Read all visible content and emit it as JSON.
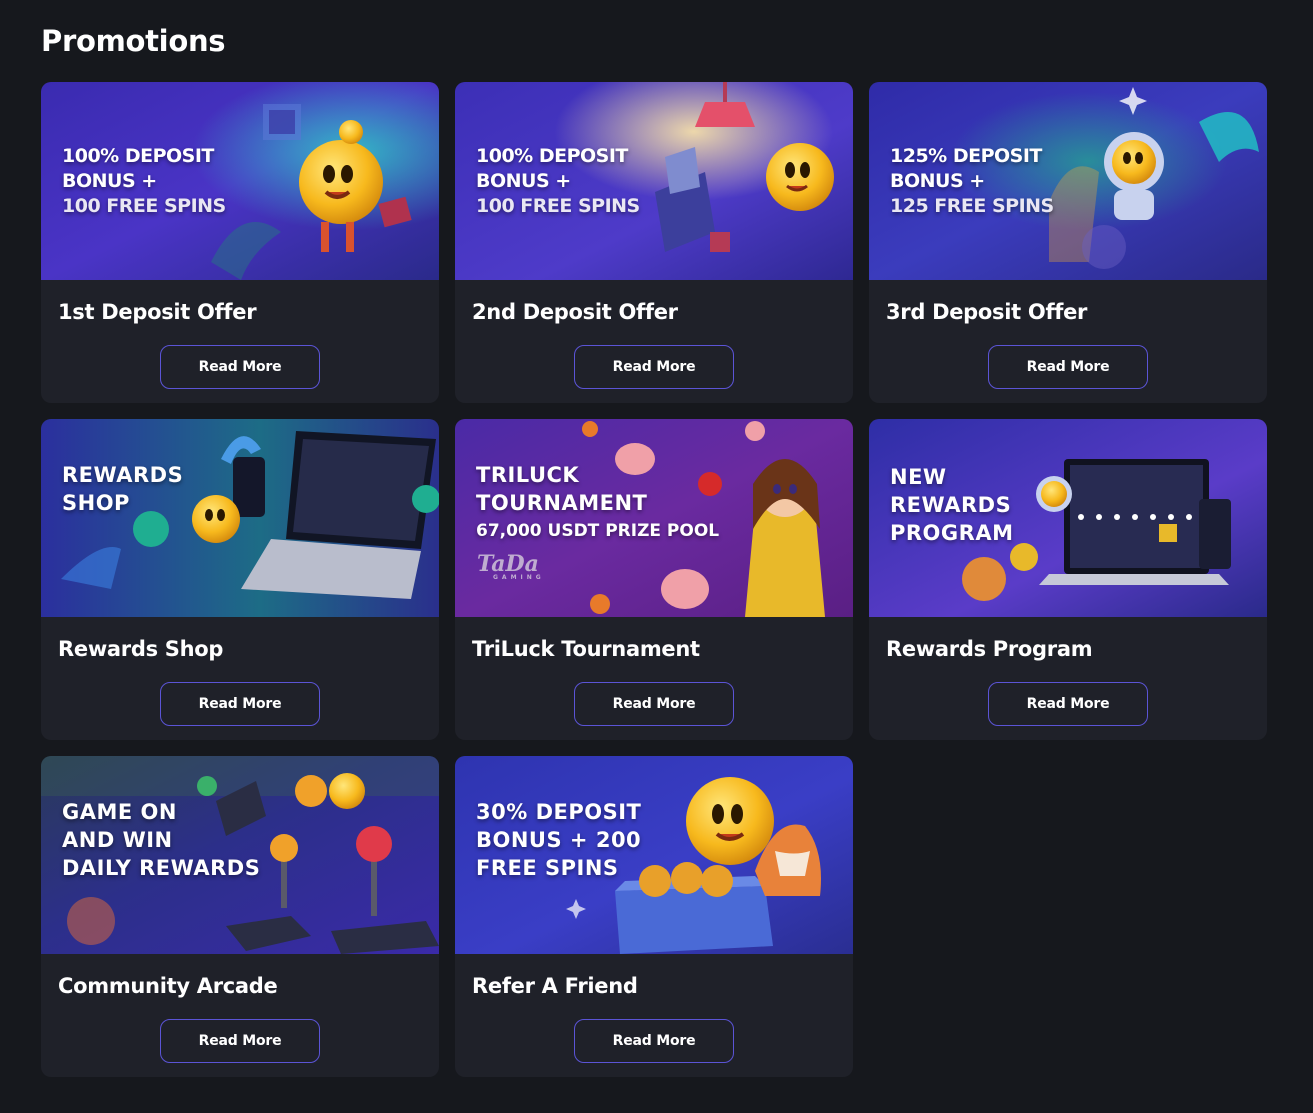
{
  "page": {
    "title": "Promotions"
  },
  "colors": {
    "background": "#16181d",
    "card": "#1f2129",
    "button_border": "#5b54d6",
    "text": "#ffffff"
  },
  "promotions": [
    {
      "title": "1st Deposit Offer",
      "banner_lines": [
        "100% DEPOSIT",
        "BONUS +",
        "100 FREE SPINS"
      ],
      "button_label": "Read More"
    },
    {
      "title": "2nd Deposit Offer",
      "banner_lines": [
        "100% DEPOSIT",
        "BONUS +",
        "100 FREE SPINS"
      ],
      "button_label": "Read More"
    },
    {
      "title": "3rd Deposit Offer",
      "banner_lines": [
        "125% DEPOSIT",
        "BONUS +",
        "125 FREE SPINS"
      ],
      "button_label": "Read More"
    },
    {
      "title": "Rewards Shop",
      "banner_lines": [
        "REWARDS",
        "SHOP"
      ],
      "button_label": "Read More"
    },
    {
      "title": "TriLuck Tournament",
      "banner_lines": [
        "TRILUCK",
        "TOURNAMENT",
        "67,000 USDT PRIZE POOL"
      ],
      "banner_logo": "TaDa",
      "banner_logo_sub": "GAMING",
      "button_label": "Read More"
    },
    {
      "title": "Rewards Program",
      "banner_lines": [
        "NEW",
        "REWARDS",
        "PROGRAM"
      ],
      "button_label": "Read More"
    },
    {
      "title": "Community Arcade",
      "banner_lines": [
        "GAME ON",
        "AND WIN",
        "DAILY REWARDS"
      ],
      "button_label": "Read More"
    },
    {
      "title": "Refer A Friend",
      "banner_lines": [
        "30% DEPOSIT",
        "BONUS + 200",
        "FREE SPINS"
      ],
      "button_label": "Read More"
    }
  ]
}
